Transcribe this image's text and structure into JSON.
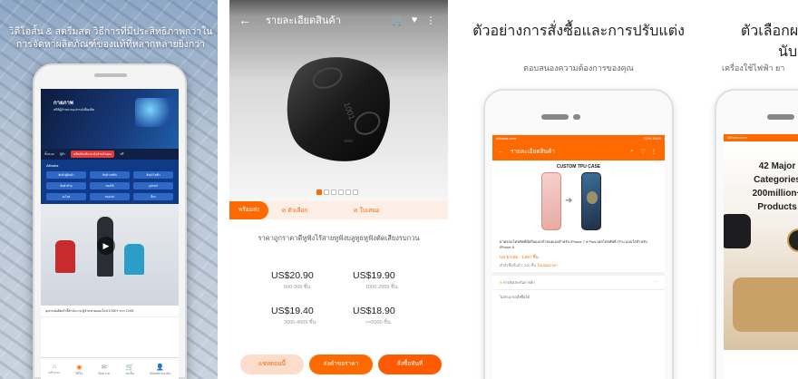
{
  "panel1": {
    "headline": "วิดีโอสั้น & สตรีมสด วิธีการที่มีประสิทธิภาพกว่าในการจัดหาผลิตภัณฑ์ของแท้ที่หลากหลายยิ่งกว่า",
    "banner_title": "กายภาพ",
    "banner_sub": "สถิติผู้จำหน่ายอุปกรณ์เพื่อผลิต",
    "tabs": [
      "ทั้งหมด",
      "ผู้ค้า",
      "ผลิตภัณฑ์แนะนำสำหรับคุณ",
      "ฟรี"
    ],
    "category_header": "Alibaba",
    "categories": [
      "สินค้าตู้สินค้า",
      "สินค้าแฟชั่น",
      "สินค้าไฟฟ้า",
      "สินค้าบ้าน",
      "ของใช้",
      "อุปกรณ์",
      "อะไหล่",
      "ของเล่น",
      "อื่นๆ"
    ],
    "caption": "อุปกรณ์ผลิตเก้าอี้สำนักงาน ผู้จำหน่ายออนไลน์ 1,000+ จาก 2,000",
    "nav": [
      {
        "icon": "⌂",
        "label": "หน้าแรก"
      },
      {
        "icon": "◉",
        "label": "วิดีโอ"
      },
      {
        "icon": "✉",
        "label": "ข้อความ"
      },
      {
        "icon": "🛒",
        "label": "รถเข็น"
      },
      {
        "icon": "👤",
        "label": "Alibaba ของฉัน"
      }
    ]
  },
  "panel2": {
    "title": "รายละเอียดสินค้า",
    "icons": {
      "back": "←",
      "cart": "🛒",
      "fav": "♥",
      "more": "⋮"
    },
    "image_dots": 6,
    "active_dot": 0,
    "tabs": [
      "พร้อมส่ง",
      "ตัวเลือก",
      "ใบเสนอ"
    ],
    "description": "ราคาถูกราคาดีหูฟังไร้สายหูฟังบลูทูธหูฟังตัดเสียงรบกวน",
    "prices": [
      {
        "price": "US$20.90",
        "qty": "500-999 ชิ้น"
      },
      {
        "price": "US$19.90",
        "qty": "1000-2999 ชิ้น"
      },
      {
        "price": "US$19.40",
        "qty": "3000-4999 ชิ้น"
      },
      {
        "price": "US$18.90",
        "qty": ">=5000 ชิ้น"
      }
    ],
    "buttons": [
      "แชทตอนนี้",
      "ส่งคำขอราคา",
      "สั่งซื้อทันที"
    ]
  },
  "panel3": {
    "headline": "ตัวอย่างการสั่งซื้อและการปรับแต่ง",
    "subheadline": "ตอบสนองความต้องการของคุณ",
    "status_left": "Alibaba.com",
    "status_right": "72% 10:00",
    "title": "รายละเอียดสินค้า",
    "case_label": "CUSTOM TPU CASE",
    "product_title": "ฝาครอบโทรศัพท์มือถือแบบกำหนดเองสำหรับ iPhone 7 8 Plus เคสโทรศัพท์ TPU แบบใสสำหรับ iPhone 8",
    "price": "US $ 0.85 - 1.09 / ชิ้น",
    "min_order_label": "คำสั่งซื้อขั้นต่ำ: 200 ชิ้น",
    "min_order_link": "ใบเสนอราคา",
    "row1_label": "การรับประกันการค้า",
    "row1_more": "···",
    "row2_label": "ไม่สามารถสั่งซื้อได้"
  },
  "panel4": {
    "headline_line1": "ตัวเลือกผลิตภัณฑ์",
    "headline_line2": "นับล้าน",
    "subheadline": "เครื่องใช้ไฟฟ้า ยา",
    "status_left": "Alibaba.com",
    "promo_title": "42 Major Categories 200million+ Products"
  }
}
